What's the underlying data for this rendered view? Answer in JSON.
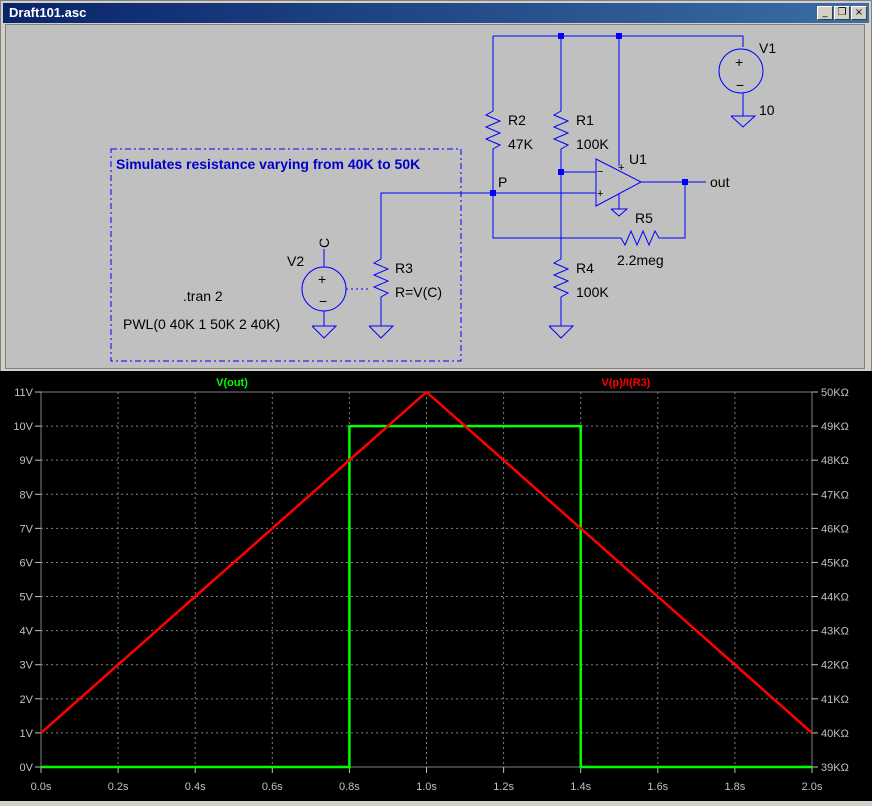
{
  "window": {
    "title": "Draft101.asc",
    "controls": {
      "minimize": "_",
      "restore": "❐",
      "close": "×"
    }
  },
  "schematic": {
    "labels": {
      "v1": "V1",
      "v1_value": "10",
      "r2": "R2",
      "r2_value": "47K",
      "r1": "R1",
      "r1_value": "100K",
      "u1": "U1",
      "node_p": "P",
      "out": "out",
      "r5": "R5",
      "r5_value": "2.2meg",
      "r4": "R4",
      "r4_value": "100K",
      "r3": "R3",
      "r3_value": "R=V(C)",
      "v2": "V2",
      "node_c": "C",
      "comment": "Simulates resistance varying from 40K to 50K",
      "tran": ".tran 2",
      "pwl": "PWL(0 40K 1 50K 2 40K)",
      "plus": "+",
      "minus": "−"
    }
  },
  "plot": {
    "trace1_label": "V(out)",
    "trace2_label": "V(p)/I(R3)",
    "colors": {
      "trace1": "#00ff00",
      "trace2": "#ff0000",
      "grid": "#808080",
      "axis_text": "#c0c0c0"
    },
    "left_axis": [
      "11V",
      "10V",
      "9V",
      "8V",
      "7V",
      "6V",
      "5V",
      "4V",
      "3V",
      "2V",
      "1V",
      "0V"
    ],
    "right_axis": [
      "50KΩ",
      "49KΩ",
      "48KΩ",
      "47KΩ",
      "46KΩ",
      "45KΩ",
      "44KΩ",
      "43KΩ",
      "42KΩ",
      "41KΩ",
      "40KΩ",
      "39KΩ"
    ],
    "x_axis": [
      "0.0s",
      "0.2s",
      "0.4s",
      "0.6s",
      "0.8s",
      "1.0s",
      "1.2s",
      "1.4s",
      "1.6s",
      "1.8s",
      "2.0s"
    ]
  },
  "chart_data": {
    "type": "line",
    "xlabel": "",
    "x_range": [
      0,
      2
    ],
    "ylim_left": [
      0,
      11
    ],
    "ylim_right": [
      39000,
      50000
    ],
    "grid": true,
    "series": [
      {
        "name": "V(out)",
        "axis": "left",
        "x": [
          0,
          0.8,
          0.8,
          1.4,
          1.4,
          2.0
        ],
        "values": [
          0,
          0,
          10,
          10,
          0,
          0
        ]
      },
      {
        "name": "V(p)/I(R3)",
        "axis": "right",
        "x": [
          0,
          1.0,
          2.0
        ],
        "values": [
          40000,
          50000,
          40000
        ]
      }
    ]
  }
}
